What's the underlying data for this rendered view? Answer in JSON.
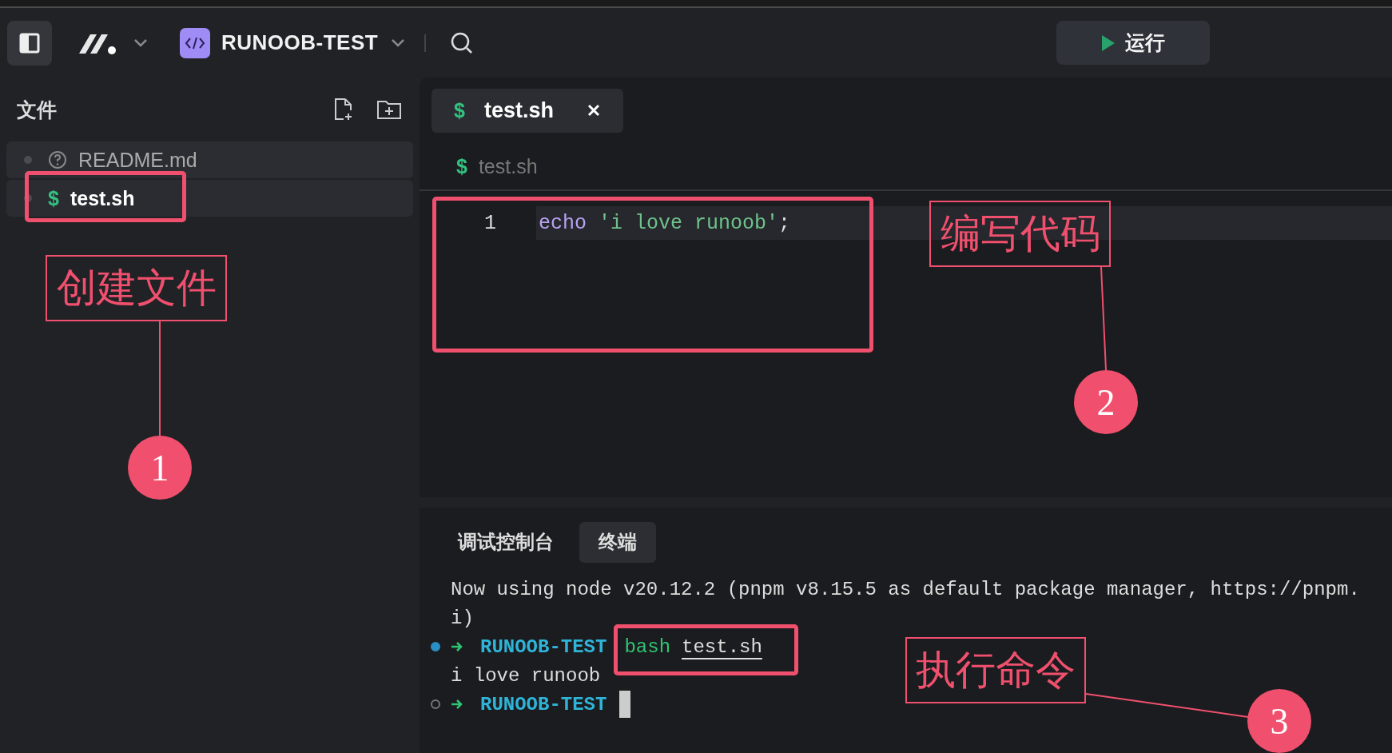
{
  "toolbar": {
    "project": "RUNOOB-TEST",
    "run_button": "运行"
  },
  "sidebar": {
    "title": "文件",
    "items": [
      {
        "name": "README.md",
        "kind": "unknown",
        "selected": false
      },
      {
        "name": "test.sh",
        "kind": "shell",
        "icon": "$",
        "selected": true
      }
    ]
  },
  "editor": {
    "tabs": [
      {
        "label": "test.sh",
        "kind": "shell",
        "icon": "$",
        "selected": true
      }
    ],
    "breadcrumb": {
      "icon": "$",
      "text": "test.sh"
    },
    "lines": [
      {
        "number": "1",
        "tokens": [
          {
            "text": "echo ",
            "kind": "keyword"
          },
          {
            "text": "'i love runoob'",
            "kind": "string"
          },
          {
            "text": ";",
            "kind": "punct"
          }
        ]
      }
    ]
  },
  "panel": {
    "tabs": [
      {
        "label": "调试控制台",
        "selected": false
      },
      {
        "label": "终端",
        "selected": true
      }
    ],
    "lines": [
      {
        "kind": "output",
        "text": "Now using node v20.12.2 (pnpm v8.15.5 as default package manager, https://pnpm."
      },
      {
        "kind": "output",
        "text": "i)"
      },
      {
        "kind": "prompt",
        "finished": true,
        "dir": "RUNOOB-TEST",
        "command": "bash",
        "argument": "test.sh"
      },
      {
        "kind": "output",
        "text": "i love runoob"
      },
      {
        "kind": "prompt",
        "finished": false,
        "dir": "RUNOOB-TEST"
      }
    ]
  },
  "annotations": [
    {
      "number": "1",
      "label": "创建文件"
    },
    {
      "number": "2",
      "label": "编写代码"
    },
    {
      "number": "3",
      "label": "执行命令"
    }
  ]
}
